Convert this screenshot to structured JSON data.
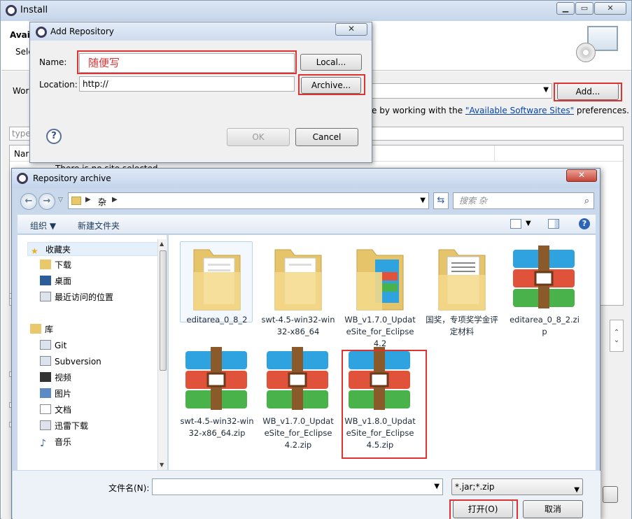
{
  "install": {
    "title": "Install",
    "band_title": "Avai",
    "band_subtitle": "Sele",
    "work_label": "Wor",
    "add_button": "Add...",
    "sites_prefix": "e by working with the ",
    "sites_link": "\"Available Software Sites\"",
    "sites_suffix": " preferences.",
    "filter_placeholder": "type",
    "tree_header": "Nar",
    "tree_message": "There is no site selected."
  },
  "add_repository": {
    "title": "Add Repository",
    "name_label": "Name:",
    "name_value": "随便写",
    "local_button": "Local...",
    "location_label": "Location:",
    "location_value": "http://",
    "archive_button": "Archive...",
    "ok_button": "OK",
    "cancel_button": "Cancel",
    "help_glyph": "?"
  },
  "repository_archive": {
    "title": "Repository archive",
    "breadcrumb": "杂",
    "search_placeholder": "搜索 杂",
    "toolbar": {
      "organize": "组织 ▼",
      "new_folder": "新建文件夹"
    },
    "nav": {
      "favorites": "收藏夹",
      "favorites_items": [
        "下载",
        "桌面",
        "最近访问的位置"
      ],
      "library": "库",
      "library_items": [
        "Git",
        "Subversion",
        "视频",
        "图片",
        "文档",
        "迅雷下载",
        "音乐"
      ]
    },
    "files": [
      {
        "label": "editarea_0_8_2",
        "kind": "folder"
      },
      {
        "label": "swt-4.5-win32-win32-x86_64",
        "kind": "folder"
      },
      {
        "label": "WB_v1.7.0_UpdateSite_for_Eclipse4.2",
        "kind": "folder"
      },
      {
        "label": "国奖，专项奖学金评定材料",
        "kind": "folder"
      },
      {
        "label": "editarea_0_8_2.zip",
        "kind": "archive"
      },
      {
        "label": "swt-4.5-win32-win32-x86_64.zip",
        "kind": "archive"
      },
      {
        "label": "WB_v1.7.0_UpdateSite_for_Eclipse4.2.zip",
        "kind": "archive"
      },
      {
        "label": "WB_v1.8.0_UpdateSite_for_Eclipse4.5.zip",
        "kind": "archive"
      }
    ],
    "filename_label": "文件名(N):",
    "filename_value": "",
    "filter_value": "*.jar;*.zip",
    "open_button": "打开(O)",
    "cancel_button": "取消"
  },
  "colors": {
    "highlight_box": "#dd3333",
    "link": "#0645ad",
    "archive_blue": "#2fa3df",
    "archive_red": "#e0523a",
    "archive_green": "#49b24a"
  }
}
